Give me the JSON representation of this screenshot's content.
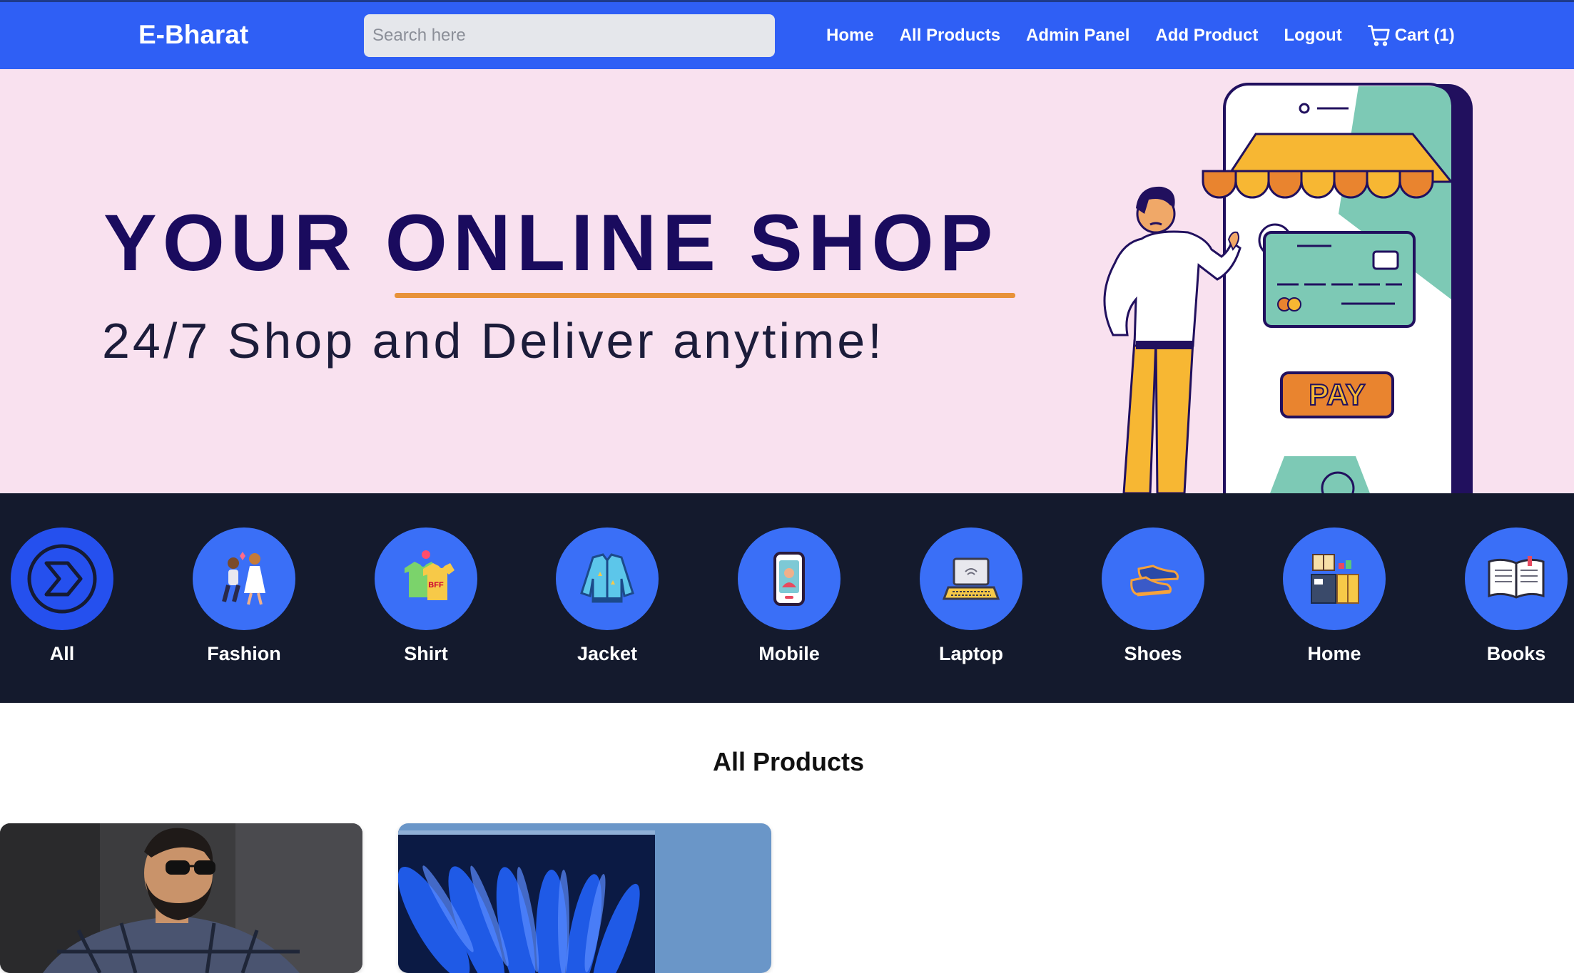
{
  "navbar": {
    "brand": "E-Bharat",
    "search_placeholder": "Search here",
    "links": [
      "Home",
      "All Products",
      "Admin Panel",
      "Add Product",
      "Logout"
    ],
    "cart_label": "Cart (1)",
    "bg_color": "#2f5ff5"
  },
  "banner": {
    "title": "YOUR ONLINE SHOP",
    "subtitle": "24/7 Shop and Deliver anytime!",
    "pay_label": "PAY",
    "bg_color": "#f9e1ef"
  },
  "categories": [
    {
      "name": "All",
      "icon": "arrow-chevron-icon"
    },
    {
      "name": "Fashion",
      "icon": "couple-icon"
    },
    {
      "name": "Shirt",
      "icon": "tshirt-icon"
    },
    {
      "name": "Jacket",
      "icon": "jacket-icon"
    },
    {
      "name": "Mobile",
      "icon": "mobile-icon"
    },
    {
      "name": "Laptop",
      "icon": "laptop-icon"
    },
    {
      "name": "Shoes",
      "icon": "shoes-icon"
    },
    {
      "name": "Home",
      "icon": "furniture-icon"
    },
    {
      "name": "Books",
      "icon": "book-icon"
    }
  ],
  "products_section": {
    "title": "All Products",
    "products": [
      {
        "image": "man-in-checked-shirt-photo"
      },
      {
        "image": "blue-laptop-photo"
      }
    ]
  }
}
